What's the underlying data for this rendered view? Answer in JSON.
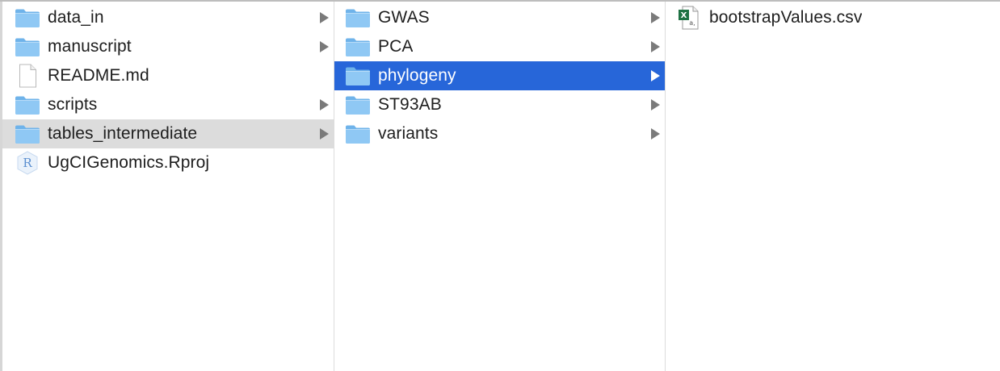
{
  "colors": {
    "selection_active": "#2766d9",
    "selection_inactive": "#dcdcdc",
    "folder_body": "#8fc8f4",
    "folder_tab": "#6fb3ea"
  },
  "columns": [
    {
      "items": [
        {
          "label": "data_in",
          "icon": "folder-icon",
          "has_children": true
        },
        {
          "label": "manuscript",
          "icon": "folder-icon",
          "has_children": true
        },
        {
          "label": "README.md",
          "icon": "document-icon",
          "has_children": false
        },
        {
          "label": "scripts",
          "icon": "folder-icon",
          "has_children": true
        },
        {
          "label": "tables_intermediate",
          "icon": "folder-icon",
          "has_children": true,
          "selected": "inactive"
        },
        {
          "label": "UgCIGenomics.Rproj",
          "icon": "rproj-file-icon",
          "has_children": false
        }
      ]
    },
    {
      "items": [
        {
          "label": "GWAS",
          "icon": "folder-icon",
          "has_children": true
        },
        {
          "label": "PCA",
          "icon": "folder-icon",
          "has_children": true
        },
        {
          "label": "phylogeny",
          "icon": "folder-icon",
          "has_children": true,
          "selected": "active"
        },
        {
          "label": "ST93AB",
          "icon": "folder-icon",
          "has_children": true
        },
        {
          "label": "variants",
          "icon": "folder-icon",
          "has_children": true
        }
      ]
    },
    {
      "items": [
        {
          "label": "bootstrapValues.csv",
          "icon": "excel-csv-file-icon",
          "has_children": false
        }
      ]
    }
  ]
}
